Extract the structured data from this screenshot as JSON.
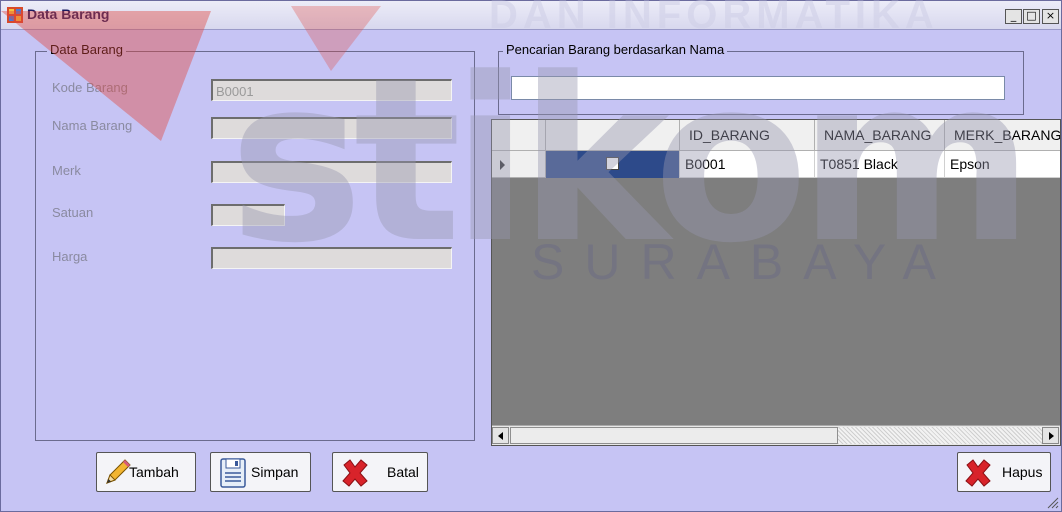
{
  "window": {
    "title": "Data Barang",
    "controls": {
      "minimize": "_",
      "maximize": "□",
      "close": "×"
    }
  },
  "watermark": {
    "top_text": "DAN INFORMATIKA",
    "brand": "stikom",
    "city": "SURABAYA"
  },
  "form": {
    "group_title": "Data Barang",
    "fields": {
      "kode": {
        "label": "Kode Barang",
        "value": "B0001"
      },
      "nama": {
        "label": "Nama Barang",
        "value": ""
      },
      "merk": {
        "label": "Merk",
        "value": ""
      },
      "satuan": {
        "label": "Satuan",
        "value": ""
      },
      "harga": {
        "label": "Harga",
        "value": ""
      }
    }
  },
  "search": {
    "group_title": "Pencarian Barang berdasarkan Nama",
    "value": ""
  },
  "grid": {
    "columns": [
      "",
      "ID_BARANG",
      "NAMA_BARANG",
      "MERK_BARANG"
    ],
    "rows": [
      {
        "checked": false,
        "id": "B0001",
        "nama": "T0851 Black",
        "merk": "Epson"
      }
    ]
  },
  "buttons": {
    "tambah": "Tambah",
    "simpan": "Simpan",
    "batal": "Batal",
    "hapus": "Hapus"
  },
  "colors": {
    "window_bg": "#c6c4f4",
    "selected_cell": "#2d4a8a",
    "grid_empty": "#7e7e7e"
  }
}
